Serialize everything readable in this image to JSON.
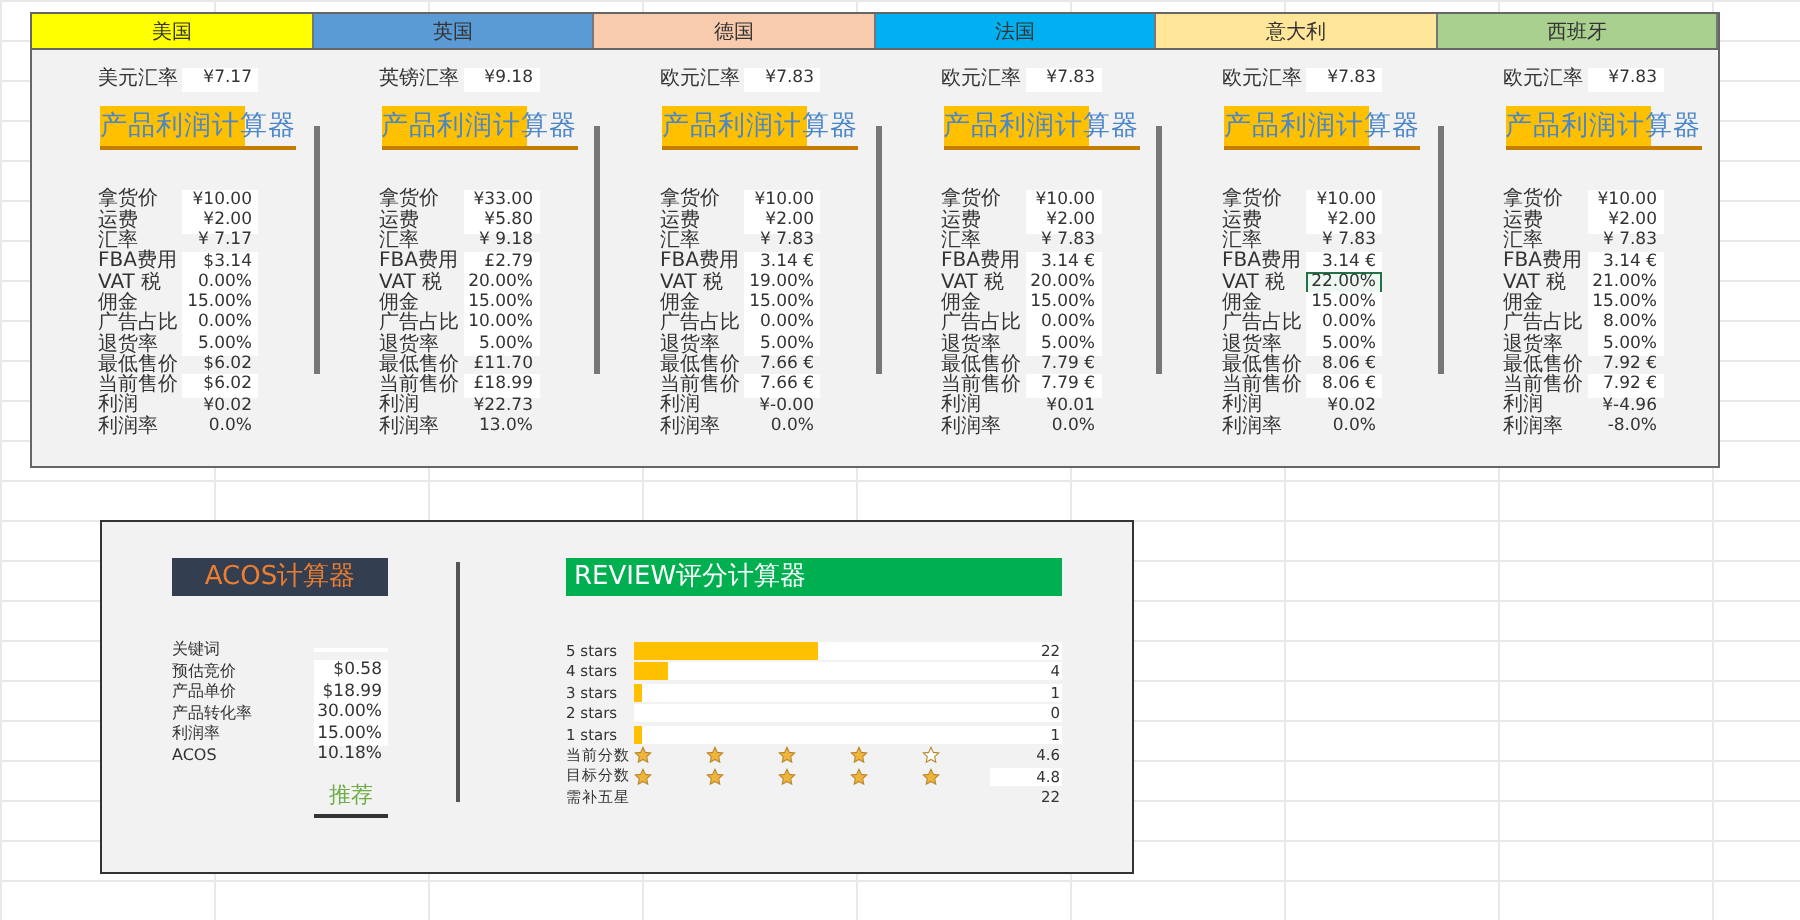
{
  "profit_panel": {
    "countries": [
      {
        "name": "美国",
        "color": "#ffff00",
        "rate_label": "美元汇率",
        "rate_value": "¥7.17",
        "title": "产品利润计算器",
        "rows": [
          {
            "label": "拿货价",
            "value": "¥10.00",
            "kind": "input",
            "selected": false
          },
          {
            "label": "运费",
            "value": "¥2.00",
            "kind": "input",
            "selected": false
          },
          {
            "label": "汇率",
            "value": "¥ 7.17",
            "kind": "output",
            "selected": false
          },
          {
            "label": "FBA费用",
            "value": "$3.14",
            "kind": "input",
            "selected": false
          },
          {
            "label": "VAT 税",
            "value": "0.00%",
            "kind": "input",
            "selected": false
          },
          {
            "label": "佣金",
            "value": "15.00%",
            "kind": "input",
            "selected": false
          },
          {
            "label": "广告占比",
            "value": "0.00%",
            "kind": "input",
            "selected": false
          },
          {
            "label": "退货率",
            "value": "5.00%",
            "kind": "input",
            "selected": false
          },
          {
            "label": "最低售价",
            "value": "$6.02",
            "kind": "output",
            "selected": false
          },
          {
            "label": "当前售价",
            "value": "$6.02",
            "kind": "input",
            "selected": false
          },
          {
            "label": "利润",
            "value": "¥0.02",
            "kind": "output",
            "selected": false
          },
          {
            "label": "利润率",
            "value": "0.0%",
            "kind": "output",
            "selected": false
          }
        ]
      },
      {
        "name": "英国",
        "color": "#5b9bd5",
        "rate_label": "英镑汇率",
        "rate_value": "¥9.18",
        "title": "产品利润计算器",
        "rows": [
          {
            "label": "拿货价",
            "value": "¥33.00",
            "kind": "input",
            "selected": false
          },
          {
            "label": "运费",
            "value": "¥5.80",
            "kind": "input",
            "selected": false
          },
          {
            "label": "汇率",
            "value": "¥ 9.18",
            "kind": "output",
            "selected": false
          },
          {
            "label": "FBA费用",
            "value": "£2.79",
            "kind": "input",
            "selected": false
          },
          {
            "label": "VAT 税",
            "value": "20.00%",
            "kind": "input",
            "selected": false
          },
          {
            "label": "佣金",
            "value": "15.00%",
            "kind": "input",
            "selected": false
          },
          {
            "label": "广告占比",
            "value": "10.00%",
            "kind": "input",
            "selected": false
          },
          {
            "label": "退货率",
            "value": "5.00%",
            "kind": "input",
            "selected": false
          },
          {
            "label": "最低售价",
            "value": "£11.70",
            "kind": "output",
            "selected": false
          },
          {
            "label": "当前售价",
            "value": "£18.99",
            "kind": "input",
            "selected": false
          },
          {
            "label": "利润",
            "value": "¥22.73",
            "kind": "output",
            "selected": false
          },
          {
            "label": "利润率",
            "value": "13.0%",
            "kind": "output",
            "selected": false
          }
        ]
      },
      {
        "name": "德国",
        "color": "#f8cbad",
        "rate_label": "欧元汇率",
        "rate_value": "¥7.83",
        "title": "产品利润计算器",
        "rows": [
          {
            "label": "拿货价",
            "value": "¥10.00",
            "kind": "input",
            "selected": false
          },
          {
            "label": "运费",
            "value": "¥2.00",
            "kind": "input",
            "selected": false
          },
          {
            "label": "汇率",
            "value": "¥ 7.83",
            "kind": "output",
            "selected": false
          },
          {
            "label": "FBA费用",
            "value": "3.14 €",
            "kind": "input",
            "selected": false
          },
          {
            "label": "VAT 税",
            "value": "19.00%",
            "kind": "input",
            "selected": false
          },
          {
            "label": "佣金",
            "value": "15.00%",
            "kind": "input",
            "selected": false
          },
          {
            "label": "广告占比",
            "value": "0.00%",
            "kind": "input",
            "selected": false
          },
          {
            "label": "退货率",
            "value": "5.00%",
            "kind": "input",
            "selected": false
          },
          {
            "label": "最低售价",
            "value": "7.66 €",
            "kind": "output",
            "selected": false
          },
          {
            "label": "当前售价",
            "value": "7.66 €",
            "kind": "input",
            "selected": false
          },
          {
            "label": "利润",
            "value": "¥-0.00",
            "kind": "output",
            "selected": false
          },
          {
            "label": "利润率",
            "value": "0.0%",
            "kind": "output",
            "selected": false
          }
        ]
      },
      {
        "name": "法国",
        "color": "#00b0f0",
        "rate_label": "欧元汇率",
        "rate_value": "¥7.83",
        "title": "产品利润计算器",
        "rows": [
          {
            "label": "拿货价",
            "value": "¥10.00",
            "kind": "input",
            "selected": false
          },
          {
            "label": "运费",
            "value": "¥2.00",
            "kind": "input",
            "selected": false
          },
          {
            "label": "汇率",
            "value": "¥ 7.83",
            "kind": "output",
            "selected": false
          },
          {
            "label": "FBA费用",
            "value": "3.14 €",
            "kind": "input",
            "selected": false
          },
          {
            "label": "VAT 税",
            "value": "20.00%",
            "kind": "input",
            "selected": false
          },
          {
            "label": "佣金",
            "value": "15.00%",
            "kind": "input",
            "selected": false
          },
          {
            "label": "广告占比",
            "value": "0.00%",
            "kind": "input",
            "selected": false
          },
          {
            "label": "退货率",
            "value": "5.00%",
            "kind": "input",
            "selected": false
          },
          {
            "label": "最低售价",
            "value": "7.79 €",
            "kind": "output",
            "selected": false
          },
          {
            "label": "当前售价",
            "value": "7.79 €",
            "kind": "input",
            "selected": false
          },
          {
            "label": "利润",
            "value": "¥0.01",
            "kind": "output",
            "selected": false
          },
          {
            "label": "利润率",
            "value": "0.0%",
            "kind": "output",
            "selected": false
          }
        ]
      },
      {
        "name": "意大利",
        "color": "#ffe699",
        "rate_label": "欧元汇率",
        "rate_value": "¥7.83",
        "title": "产品利润计算器",
        "rows": [
          {
            "label": "拿货价",
            "value": "¥10.00",
            "kind": "input",
            "selected": false
          },
          {
            "label": "运费",
            "value": "¥2.00",
            "kind": "input",
            "selected": false
          },
          {
            "label": "汇率",
            "value": "¥ 7.83",
            "kind": "output",
            "selected": false
          },
          {
            "label": "FBA费用",
            "value": "3.14 €",
            "kind": "input",
            "selected": false
          },
          {
            "label": "VAT 税",
            "value": "22.00%",
            "kind": "input",
            "selected": true
          },
          {
            "label": "佣金",
            "value": "15.00%",
            "kind": "input",
            "selected": false
          },
          {
            "label": "广告占比",
            "value": "0.00%",
            "kind": "input",
            "selected": false
          },
          {
            "label": "退货率",
            "value": "5.00%",
            "kind": "input",
            "selected": false
          },
          {
            "label": "最低售价",
            "value": "8.06 €",
            "kind": "output",
            "selected": false
          },
          {
            "label": "当前售价",
            "value": "8.06 €",
            "kind": "input",
            "selected": false
          },
          {
            "label": "利润",
            "value": "¥0.02",
            "kind": "output",
            "selected": false
          },
          {
            "label": "利润率",
            "value": "0.0%",
            "kind": "output",
            "selected": false
          }
        ]
      },
      {
        "name": "西班牙",
        "color": "#a9d08e",
        "rate_label": "欧元汇率",
        "rate_value": "¥7.83",
        "title": "产品利润计算器",
        "rows": [
          {
            "label": "拿货价",
            "value": "¥10.00",
            "kind": "input",
            "selected": false
          },
          {
            "label": "运费",
            "value": "¥2.00",
            "kind": "input",
            "selected": false
          },
          {
            "label": "汇率",
            "value": "¥ 7.83",
            "kind": "output",
            "selected": false
          },
          {
            "label": "FBA费用",
            "value": "3.14 €",
            "kind": "input",
            "selected": false
          },
          {
            "label": "VAT 税",
            "value": "21.00%",
            "kind": "input",
            "selected": false
          },
          {
            "label": "佣金",
            "value": "15.00%",
            "kind": "input",
            "selected": false
          },
          {
            "label": "广告占比",
            "value": "8.00%",
            "kind": "input",
            "selected": false
          },
          {
            "label": "退货率",
            "value": "5.00%",
            "kind": "input",
            "selected": false
          },
          {
            "label": "最低售价",
            "value": "7.92 €",
            "kind": "output",
            "selected": false
          },
          {
            "label": "当前售价",
            "value": "7.92 €",
            "kind": "input",
            "selected": false
          },
          {
            "label": "利润",
            "value": "¥-4.96",
            "kind": "output",
            "selected": false
          },
          {
            "label": "利润率",
            "value": "-8.0%",
            "kind": "output",
            "selected": false
          }
        ]
      }
    ]
  },
  "acos": {
    "title": "ACOS计算器",
    "rows": [
      {
        "label": "关键词",
        "value": "",
        "kind": "input"
      },
      {
        "label": "预估竞价",
        "value": "$0.58",
        "kind": "input"
      },
      {
        "label": "产品单价",
        "value": "$18.99",
        "kind": "input"
      },
      {
        "label": "产品转化率",
        "value": "30.00%",
        "kind": "input"
      },
      {
        "label": "利润率",
        "value": "15.00%",
        "kind": "input"
      },
      {
        "label": "ACOS",
        "value": "10.18%",
        "kind": "output"
      }
    ],
    "recommend": "推荐"
  },
  "review": {
    "title": "REVIEW评分计算器",
    "bars": [
      {
        "label": "5 stars",
        "level": 0.43,
        "count": "22"
      },
      {
        "label": "4 stars",
        "level": 0.08,
        "count": "4"
      },
      {
        "label": "3 stars",
        "level": 0.02,
        "count": "1"
      },
      {
        "label": "2 stars",
        "level": 0,
        "count": "0"
      },
      {
        "label": "1 stars",
        "level": 0.02,
        "count": "1"
      }
    ],
    "scores": [
      {
        "label": "当前分数",
        "stars": 4,
        "value": "4.6",
        "kind": "output"
      },
      {
        "label": "目标分数",
        "stars": 5,
        "value": "4.8",
        "kind": "input"
      }
    ],
    "needed": {
      "label": "需补五星",
      "value": "22"
    }
  }
}
